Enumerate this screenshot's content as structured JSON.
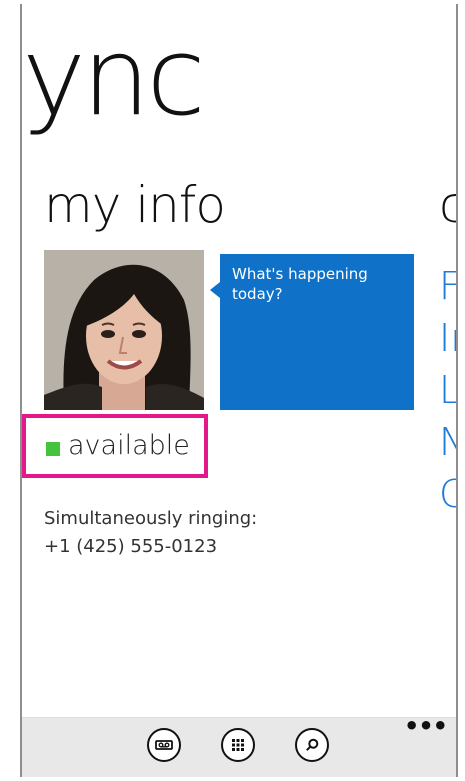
{
  "app": {
    "title": "lync"
  },
  "pivot": {
    "title": "my info",
    "next_peek": "c"
  },
  "note": {
    "text": "What's happening today?"
  },
  "presence": {
    "label": "available",
    "color": "#45c33c"
  },
  "ringing": {
    "label": "Simultaneously ringing:",
    "number": "+1 (425) 555-0123"
  },
  "peek_list": [
    "F",
    "Ir",
    "L",
    "N",
    "C"
  ],
  "app_bar": {
    "buttons": [
      {
        "icon": "voicemail-icon"
      },
      {
        "icon": "dialpad-icon"
      },
      {
        "icon": "search-icon"
      }
    ],
    "more": "•••"
  },
  "colors": {
    "accent": "#0f72c8",
    "highlight": "#e2188b",
    "presence_green": "#45c33c"
  }
}
